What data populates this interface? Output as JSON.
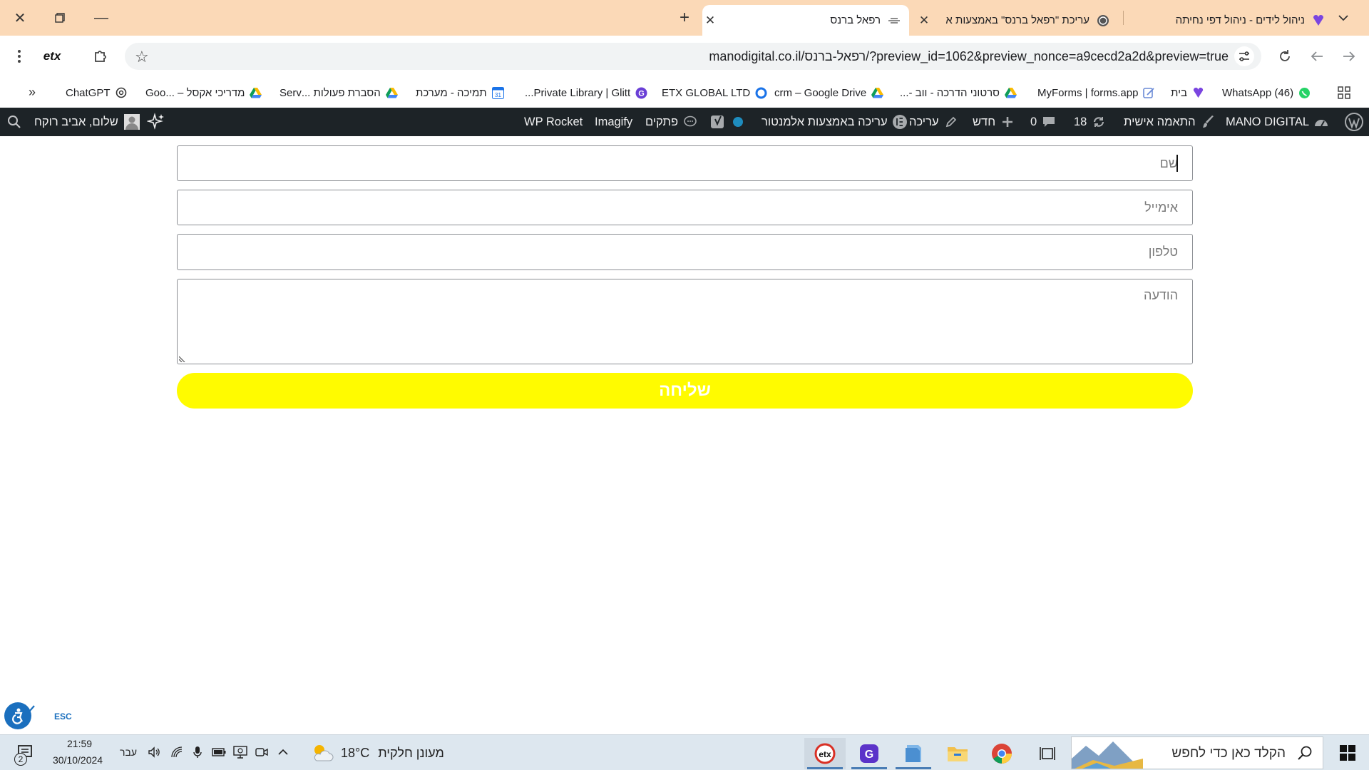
{
  "browser": {
    "tabs": [
      {
        "title": "ניהול לידים - ניהול דפי נחיתה",
        "active": false
      },
      {
        "title": "עריכת \"רפאל ברנס\" באמצעות א",
        "active": false
      },
      {
        "title": "רפאל ברנס",
        "active": true
      }
    ],
    "new_tab_label": "+",
    "url": "manodigital.co.il/רפאל-ברנס/?preview_id=1062&preview_nonce=a9cecd2a2d&preview=true",
    "extension_label": "etx"
  },
  "bookmarks": [
    {
      "label": "(46) WhatsApp",
      "icon": "whatsapp-icon"
    },
    {
      "label": "בית",
      "icon": "heart-logo-icon"
    },
    {
      "label": "MyForms | forms.app",
      "icon": "forms-app-icon"
    },
    {
      "label": "סרטוני הדרכה - ווב -...",
      "icon": "google-drive-icon"
    },
    {
      "label": "crm – Google Drive",
      "icon": "google-drive-icon"
    },
    {
      "label": "ETX GLOBAL LTD",
      "icon": "ring-icon"
    },
    {
      "label": "Private Library | Glitt...",
      "icon": "glitter-icon"
    },
    {
      "label": "תמיכה - מערכת",
      "icon": "calendar-icon"
    },
    {
      "label": "הסברת פעולות ...Serv",
      "icon": "google-drive-icon"
    },
    {
      "label": "מדריכי אקסל – ...Goo",
      "icon": "google-drive-icon"
    },
    {
      "label": "ChatGPT",
      "icon": "openai-icon"
    }
  ],
  "wp_admin_bar": {
    "site_name": "MANO DIGITAL",
    "customize": "התאמה אישית",
    "updates_count": "18",
    "comments_count": "0",
    "new": "חדש",
    "edit": "עריכה",
    "elementor_edit": "עריכה באמצעות אלמנטור",
    "snippets": "פתקים",
    "imagify": "Imagify",
    "wp_rocket": "WP Rocket",
    "greeting": "שלום, אביב רוקח"
  },
  "form": {
    "name_placeholder": "שם",
    "email_placeholder": "אימייל",
    "phone_placeholder": "טלפון",
    "message_placeholder": "הודעה",
    "submit_label": "שליחה",
    "submit_color": "#fffb00"
  },
  "accessibility": {
    "esc_label": "ESC"
  },
  "taskbar": {
    "search_placeholder": "הקלד כאן כדי לחפש",
    "weather_text": "מעונן חלקית",
    "temperature": "18°C",
    "language": "עבר",
    "time": "21:59",
    "date": "30/10/2024",
    "notification_count": "2"
  }
}
